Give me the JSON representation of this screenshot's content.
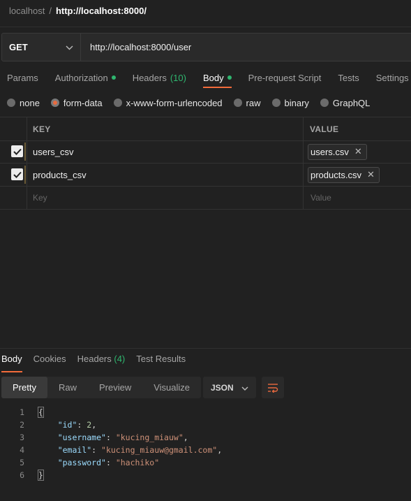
{
  "breadcrumb": {
    "parent": "localhost",
    "separator": "/",
    "current": "http://localhost:8000/"
  },
  "request": {
    "method": "GET",
    "url": "http://localhost:8000/user"
  },
  "request_tabs": [
    {
      "label": "Params"
    },
    {
      "label": "Authorization"
    },
    {
      "label": "Headers",
      "count": "(10)"
    },
    {
      "label": "Body"
    },
    {
      "label": "Pre-request Script"
    },
    {
      "label": "Tests"
    },
    {
      "label": "Settings"
    }
  ],
  "body_modes": [
    {
      "label": "none",
      "selected": false
    },
    {
      "label": "form-data",
      "selected": true
    },
    {
      "label": "x-www-form-urlencoded",
      "selected": false
    },
    {
      "label": "raw",
      "selected": false
    },
    {
      "label": "binary",
      "selected": false
    },
    {
      "label": "GraphQL",
      "selected": false
    }
  ],
  "form_table": {
    "headers": {
      "key": "KEY",
      "value": "VALUE"
    },
    "rows": [
      {
        "key": "users_csv",
        "value": "users.csv",
        "checked": true
      },
      {
        "key": "products_csv",
        "value": "products.csv",
        "checked": true
      }
    ],
    "placeholder": {
      "key": "Key",
      "value": "Value"
    }
  },
  "response_tabs": [
    {
      "label": "Body"
    },
    {
      "label": "Cookies"
    },
    {
      "label": "Headers",
      "count": "(4)"
    },
    {
      "label": "Test Results"
    }
  ],
  "view_tabs": [
    {
      "label": "Pretty"
    },
    {
      "label": "Raw"
    },
    {
      "label": "Preview"
    },
    {
      "label": "Visualize"
    }
  ],
  "format": "JSON",
  "response_lines": [
    {
      "n": "1",
      "text": "{"
    },
    {
      "n": "2",
      "key": "\"id\"",
      "value": "2",
      "type": "number"
    },
    {
      "n": "3",
      "key": "\"username\"",
      "value": "\"kucing_miauw\"",
      "type": "string"
    },
    {
      "n": "4",
      "key": "\"email\"",
      "value": "\"kucing_miauw@gmail.com\"",
      "type": "string"
    },
    {
      "n": "5",
      "key": "\"password\"",
      "value": "\"hachiko\"",
      "type": "string"
    },
    {
      "n": "6",
      "text": "}"
    }
  ],
  "colors": {
    "accent": "#f26b3a",
    "success": "#2fb66f",
    "background": "#212121"
  },
  "icons": {
    "method_dropdown": "chevron-down-icon",
    "file_remove": "close-icon",
    "wrap": "wrap-lines-icon",
    "checkbox": "check-icon"
  }
}
